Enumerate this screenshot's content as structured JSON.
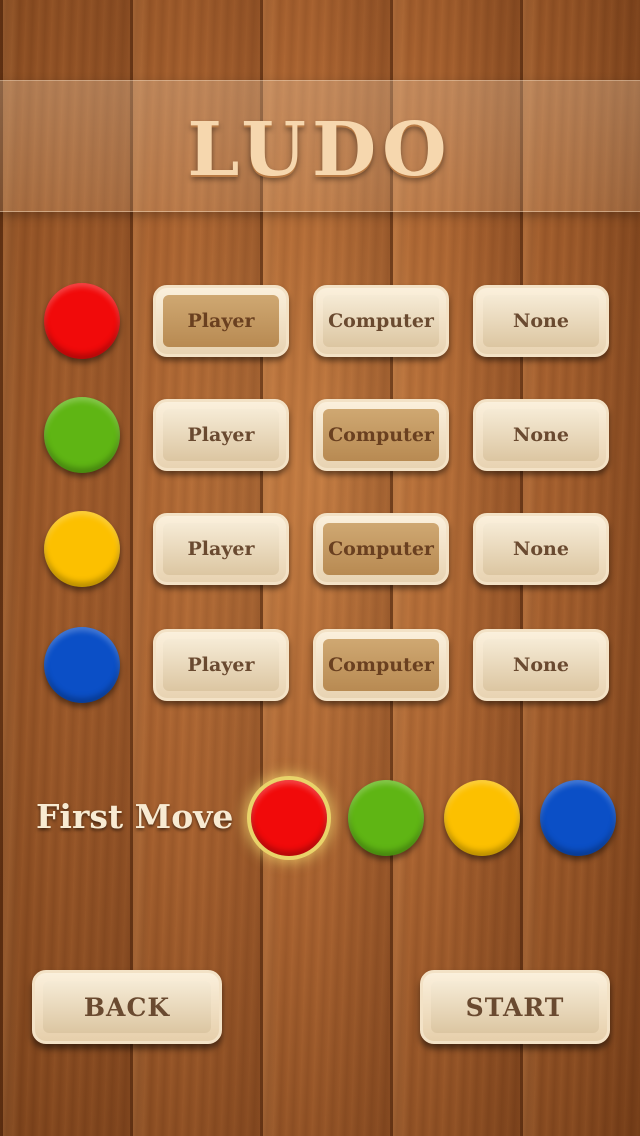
{
  "title": "LUDO",
  "options": {
    "player": "Player",
    "computer": "Computer",
    "none": "None"
  },
  "rows": [
    {
      "color_name": "red",
      "color": "#f10a0a",
      "selected": "player"
    },
    {
      "color_name": "green",
      "color": "#5fb514",
      "selected": "computer"
    },
    {
      "color_name": "yellow",
      "color": "#fcc000",
      "selected": "computer"
    },
    {
      "color_name": "blue",
      "color": "#0b4fc6",
      "selected": "computer"
    }
  ],
  "first_move": {
    "label": "First Move",
    "selected": "red",
    "tokens": [
      {
        "color_name": "red",
        "color": "#f10a0a"
      },
      {
        "color_name": "green",
        "color": "#5fb514"
      },
      {
        "color_name": "yellow",
        "color": "#fcc000"
      },
      {
        "color_name": "blue",
        "color": "#0b4fc6"
      }
    ]
  },
  "buttons": {
    "back": "BACK",
    "start": "START"
  }
}
